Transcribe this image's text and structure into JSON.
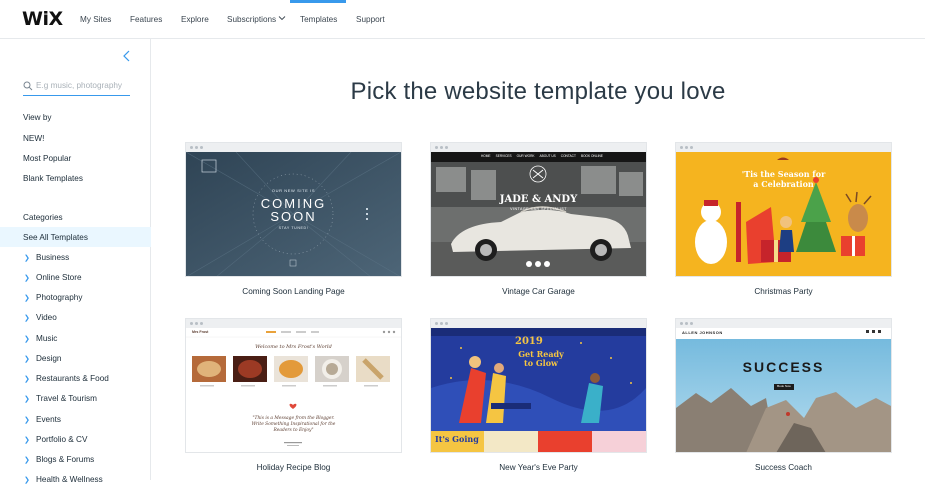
{
  "app": {
    "logo": "WiX"
  },
  "nav": {
    "items": [
      "My Sites",
      "Features",
      "Explore",
      "Subscriptions",
      "Templates",
      "Support"
    ],
    "active": "Templates"
  },
  "sidebar": {
    "search_placeholder": "E.g music, photography",
    "view_by_label": "View by",
    "view_by": [
      "NEW!",
      "Most Popular",
      "Blank Templates"
    ],
    "categories_label": "Categories",
    "see_all": "See All Templates",
    "categories": [
      "Business",
      "Online Store",
      "Photography",
      "Video",
      "Music",
      "Design",
      "Restaurants & Food",
      "Travel & Tourism",
      "Events",
      "Portfolio & CV",
      "Blogs & Forums",
      "Health & Wellness"
    ]
  },
  "main": {
    "title": "Pick the website template you love",
    "templates": [
      {
        "caption": "Coming Soon Landing Page",
        "preview": {
          "kicker": "OUR NEW SITE IS",
          "headline_1": "COMING",
          "headline_2": "SOON",
          "sub": "STAY TUNED!"
        }
      },
      {
        "caption": "Vintage Car Garage",
        "preview": {
          "menu": [
            "HOME",
            "SERVICES",
            "OUR WORK",
            "ABOUT US",
            "CONTACT",
            "BOOK ONLINE"
          ],
          "brand": "JADE & ANDY",
          "tagline": "VINTAGE CAR SPECIALIST"
        }
      },
      {
        "caption": "Christmas Party",
        "preview": {
          "headline_1": "'Tis the Season for",
          "headline_2": "a Celebration"
        }
      },
      {
        "caption": "Holiday Recipe Blog",
        "preview": {
          "site_name": "Mrs Frost",
          "heading": "Welcome to Mrs Frost's World",
          "quote_1": "\"This is a Message from the Blogger.",
          "quote_2": "Write Something Inspirational for the",
          "quote_3": "Readers to Enjoy\""
        }
      },
      {
        "caption": "New Year's Eve Party",
        "preview": {
          "year": "2019",
          "headline_1": "Get Ready",
          "headline_2": "to Glow",
          "footer": "It's Going"
        }
      },
      {
        "caption": "Success Coach",
        "preview": {
          "brand": "ALLEN JOHNSON",
          "headline": "SUCCESS",
          "button": "Book Now"
        }
      }
    ]
  },
  "colors": {
    "accent": "#3899ec",
    "active_bg": "#eaf7ff",
    "coming_soon_bg": "#3a5264",
    "christmas_bg": "#f5b41f",
    "party_bg": "#243c9e",
    "sky": "#8cc7e6"
  },
  "icons": {
    "search": "search-icon",
    "collapse": "chevron-left-icon",
    "nav_dropdown": "chevron-down-icon",
    "category_arrow": "chevron-right-icon"
  }
}
